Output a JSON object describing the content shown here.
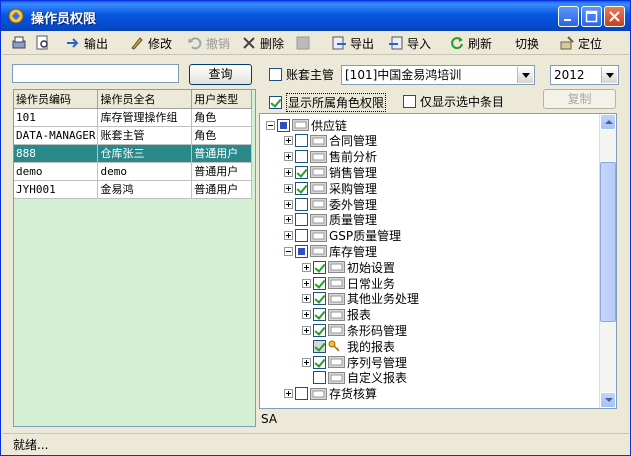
{
  "window": {
    "title": "操作员权限"
  },
  "toolbar": {
    "items": [
      {
        "label": "输出",
        "icon": "export-icon"
      },
      {
        "label": "修改",
        "icon": "edit-icon"
      },
      {
        "label": "撤销",
        "icon": "undo-icon",
        "disabled": true
      },
      {
        "label": "删除",
        "icon": "delete-icon"
      },
      {
        "label": "",
        "icon": "save-icon",
        "disabled": true
      },
      {
        "label": "导出",
        "icon": "export-file-icon"
      },
      {
        "label": "导入",
        "icon": "import-file-icon"
      },
      {
        "label": "刷新",
        "icon": "refresh-icon"
      },
      {
        "label": "切换",
        "icon": ""
      },
      {
        "label": "定位",
        "icon": "locate-icon"
      }
    ]
  },
  "search": {
    "value": "",
    "button": "查询"
  },
  "grid": {
    "headers": [
      "操作员编码",
      "操作员全名",
      "用户类型"
    ],
    "rows": [
      [
        "101",
        "库存管理操作组",
        "角色"
      ],
      [
        "DATA-MANAGER",
        "账套主管",
        "角色"
      ],
      [
        "888",
        "仓库张三",
        "普通用户"
      ],
      [
        "demo",
        "demo",
        "普通用户"
      ],
      [
        "JYH001",
        "金易鸿",
        "普通用户"
      ]
    ],
    "selected_row": 2
  },
  "options": {
    "account_manager": "账套主管",
    "account_select": "[101]中国金易鸿培训",
    "year_select": "2012",
    "show_role_rights": "显示所属角色权限",
    "show_selected_only": "仅显示选中条目",
    "copy_button": "复制"
  },
  "tree": [
    {
      "level": 0,
      "expander": "minus",
      "state": "partial",
      "label": "供应链"
    },
    {
      "level": 1,
      "expander": "plus",
      "state": "unchecked",
      "label": "合同管理"
    },
    {
      "level": 1,
      "expander": "plus",
      "state": "unchecked",
      "label": "售前分析"
    },
    {
      "level": 1,
      "expander": "plus",
      "state": "checked",
      "label": "销售管理"
    },
    {
      "level": 1,
      "expander": "plus",
      "state": "checked",
      "label": "采购管理"
    },
    {
      "level": 1,
      "expander": "plus",
      "state": "unchecked",
      "label": "委外管理"
    },
    {
      "level": 1,
      "expander": "plus",
      "state": "unchecked",
      "label": "质量管理"
    },
    {
      "level": 1,
      "expander": "plus",
      "state": "unchecked",
      "label": "GSP质量管理"
    },
    {
      "level": 1,
      "expander": "minus",
      "state": "partial",
      "label": "库存管理"
    },
    {
      "level": 2,
      "expander": "plus",
      "state": "checked",
      "label": "初始设置"
    },
    {
      "level": 2,
      "expander": "plus",
      "state": "checked",
      "label": "日常业务"
    },
    {
      "level": 2,
      "expander": "plus",
      "state": "checked",
      "label": "其他业务处理"
    },
    {
      "level": 2,
      "expander": "plus",
      "state": "checked",
      "label": "报表"
    },
    {
      "level": 2,
      "expander": "plus",
      "state": "checked",
      "label": "条形码管理"
    },
    {
      "level": 2,
      "expander": "none",
      "state": "grey-checked",
      "label": "我的报表",
      "key_icon": true
    },
    {
      "level": 2,
      "expander": "plus",
      "state": "checked",
      "label": "序列号管理"
    },
    {
      "level": 2,
      "expander": "none",
      "state": "unchecked",
      "label": "自定义报表"
    },
    {
      "level": 1,
      "expander": "plus",
      "state": "unchecked",
      "label": "存货核算"
    }
  ],
  "footer": {
    "operator": "SA",
    "status": "就绪..."
  },
  "colors": {
    "titlebar": "#0a5fe8",
    "selected_row": "#2a8a8a",
    "grid_bg": "#d4efd4",
    "check": "#21a121"
  }
}
